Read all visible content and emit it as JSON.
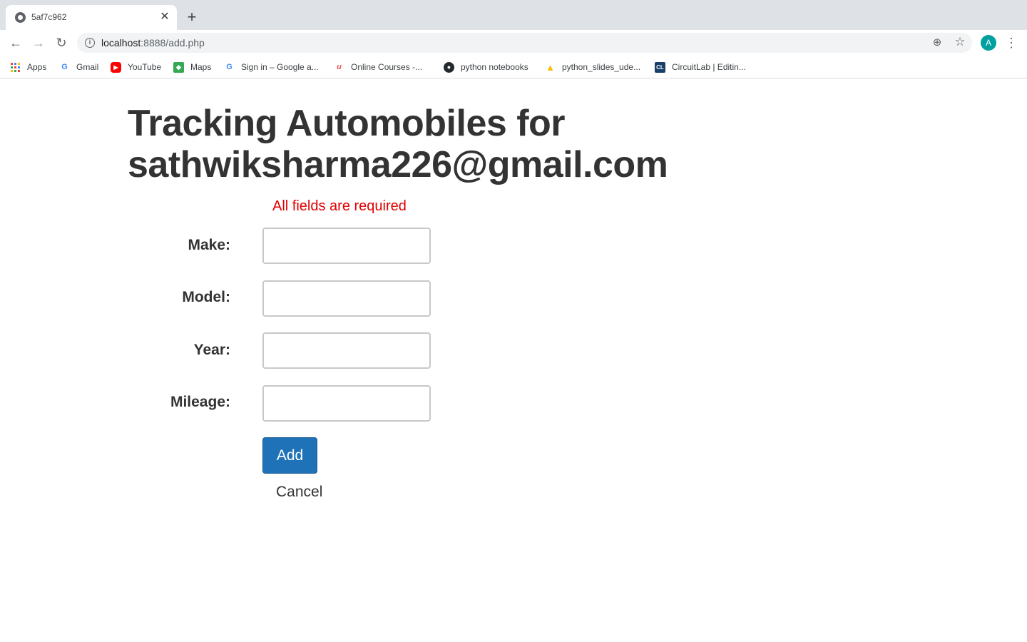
{
  "browser": {
    "tab_title": "5af7c962",
    "url_host": "localhost",
    "url_path": ":8888/add.php",
    "profile_initial": "A",
    "bookmarks": [
      {
        "label": "Apps",
        "icon": "apps-grid-icon"
      },
      {
        "label": "Gmail",
        "icon": "google-icon"
      },
      {
        "label": "YouTube",
        "icon": "youtube-icon"
      },
      {
        "label": "Maps",
        "icon": "maps-icon"
      },
      {
        "label": "Sign in – Google a...",
        "icon": "google-icon"
      },
      {
        "label": "Online Courses -...",
        "icon": "udemy-icon"
      },
      {
        "label": "python notebooks",
        "icon": "github-icon"
      },
      {
        "label": "python_slides_ude...",
        "icon": "drive-icon"
      },
      {
        "label": "CircuitLab | Editin...",
        "icon": "circuitlab-icon"
      }
    ]
  },
  "page": {
    "heading": "Tracking Automobiles for sathwiksharma226@gmail.com",
    "error_message": "All fields are required",
    "form": {
      "make_label": "Make:",
      "make_value": "",
      "model_label": "Model:",
      "model_value": "",
      "year_label": "Year:",
      "year_value": "",
      "mileage_label": "Mileage:",
      "mileage_value": "",
      "submit_label": "Add",
      "cancel_label": "Cancel"
    }
  },
  "colors": {
    "error": "#e00000",
    "primary_button": "#1f72b8",
    "text": "#333333"
  }
}
